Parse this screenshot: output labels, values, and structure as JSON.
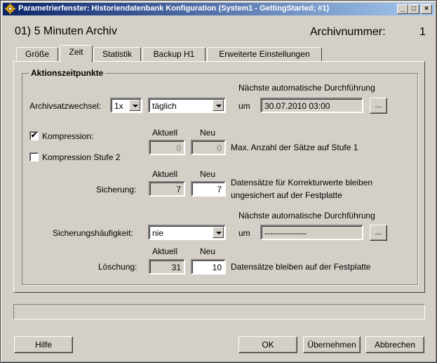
{
  "window": {
    "title": "Parametrierfenster: Historiendatenbank Konfiguration (System1 - GettingStarted; #1)"
  },
  "header": {
    "title": "01) 5 Minuten Archiv",
    "archivnummer_label": "Archivnummer:",
    "archivnummer_value": "1"
  },
  "tabs": [
    {
      "label": "Größe"
    },
    {
      "label": "Zeit",
      "active": true
    },
    {
      "label": "Statistik"
    },
    {
      "label": "Backup H1"
    },
    {
      "label": "Erweiterte Einstellungen"
    }
  ],
  "group": {
    "title": "Aktionszeitpunkte"
  },
  "archivsatzwechsel": {
    "label": "Archivsatzwechsel:",
    "multiplier": "1x",
    "interval": "täglich",
    "next_label": "Nächste automatische Durchführung",
    "um_label": "um",
    "next_value": "30.07.2010 03:00",
    "browse_label": "..."
  },
  "kompression": {
    "label": "Kompression:",
    "checked": true,
    "checkmark": "✔",
    "stufe2_label": "Kompression Stufe 2",
    "stufe2_checked": false,
    "aktuell_header": "Aktuell",
    "neu_header": "Neu",
    "aktuell_value": "0",
    "neu_value": "0",
    "description": "Max. Anzahl der Sätze auf Stufe 1"
  },
  "sicherung": {
    "label": "Sicherung:",
    "aktuell_header": "Aktuell",
    "neu_header": "Neu",
    "aktuell_value": "7",
    "neu_value": "7",
    "description_line1": "Datensätze für Korrekturwerte bleiben",
    "description_line2": "ungesichert auf der Festplatte"
  },
  "sicherungshaeufigkeit": {
    "label": "Sicherungshäufigkeit:",
    "value": "nie",
    "next_label": "Nächste automatische Durchführung",
    "um_label": "um",
    "next_value": "---------------",
    "browse_label": "..."
  },
  "loeschung": {
    "label": "Löschung:",
    "aktuell_header": "Aktuell",
    "neu_header": "Neu",
    "aktuell_value": "31",
    "neu_value": "10",
    "description": "Datensätze bleiben auf der Festplatte"
  },
  "status": {
    "text": ""
  },
  "buttons": {
    "hilfe": "Hilfe",
    "ok": "OK",
    "uebernehmen": "Übernehmen",
    "abbrechen": "Abbrechen"
  },
  "titlebar_buttons": {
    "minimize": "_",
    "maximize": "□",
    "close": "×"
  }
}
